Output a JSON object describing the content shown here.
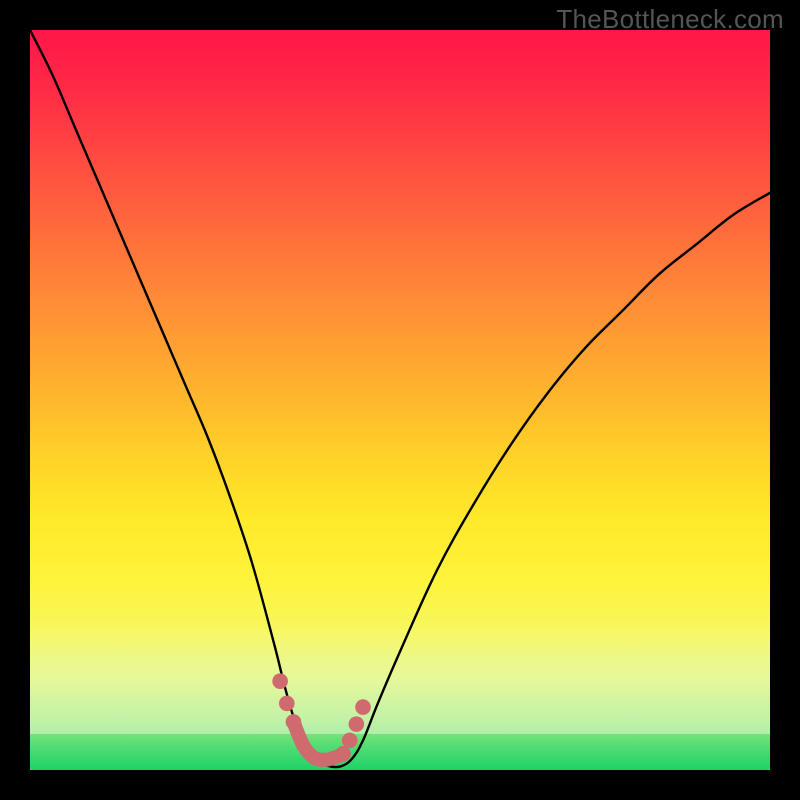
{
  "watermark": "TheBottleneck.com",
  "colors": {
    "page_bg": "#000000",
    "curve_stroke": "#000000",
    "marker_fill": "#cf6a6e",
    "marker_stroke": "#cf6a6e",
    "gradient_top": "#ff1648",
    "gradient_mid": "#ffe92a",
    "gradient_bottom": "#1fd268"
  },
  "chart_data": {
    "type": "line",
    "title": "",
    "xlabel": "",
    "ylabel": "",
    "xlim": [
      0,
      100
    ],
    "ylim": [
      0,
      100
    ],
    "grid": false,
    "series": [
      {
        "name": "bottleneck-curve",
        "x": [
          0,
          3,
          6,
          9,
          12,
          15,
          18,
          21,
          24,
          27,
          30,
          33,
          34.5,
          36,
          37.5,
          39,
          40.5,
          42,
          43.5,
          45,
          47,
          50,
          55,
          60,
          65,
          70,
          75,
          80,
          85,
          90,
          95,
          100
        ],
        "y": [
          100,
          94,
          87,
          80,
          73,
          66,
          59,
          52,
          45,
          37,
          28,
          17,
          11,
          6,
          3,
          1.2,
          0.5,
          0.5,
          1.5,
          4,
          9,
          16,
          27,
          36,
          44,
          51,
          57,
          62,
          67,
          71,
          75,
          78
        ]
      }
    ],
    "markers": {
      "name": "valley-highlight",
      "x": [
        33.8,
        34.7,
        35.6,
        42.3,
        43.2,
        44.1,
        45.0
      ],
      "y": [
        12,
        9,
        6.5,
        2.2,
        4.0,
        6.2,
        8.5
      ]
    },
    "valley_segment": {
      "x": [
        35.6,
        37.0,
        38.5,
        40.0,
        41.2,
        42.3
      ],
      "y": [
        6.5,
        3.2,
        1.6,
        1.4,
        1.7,
        2.2
      ]
    }
  }
}
